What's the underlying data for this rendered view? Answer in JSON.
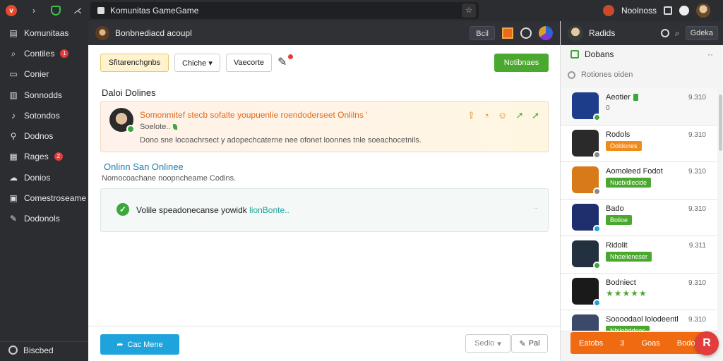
{
  "topbar": {
    "address": "Komunitas GameGame",
    "user_name": "Noolnoss"
  },
  "sidebar": {
    "items": [
      {
        "label": "Komunitaas",
        "icon": "layout-icon",
        "badge": ""
      },
      {
        "label": "Contiles",
        "icon": "search-icon",
        "badge": "1"
      },
      {
        "label": "Conier",
        "icon": "chat-icon",
        "badge": ""
      },
      {
        "label": "Sonnodds",
        "icon": "book-icon",
        "badge": ""
      },
      {
        "label": "Sotondos",
        "icon": "guitar-icon",
        "badge": ""
      },
      {
        "label": "Dodnos",
        "icon": "person-icon",
        "badge": ""
      },
      {
        "label": "Rages",
        "icon": "grid-icon",
        "badge": "2"
      },
      {
        "label": "Donios",
        "icon": "cloud-icon",
        "badge": ""
      },
      {
        "label": "Comestroseame",
        "icon": "image-icon",
        "badge": ""
      },
      {
        "label": "Dodonols",
        "icon": "pen-icon",
        "badge": ""
      }
    ],
    "footer_label": "Biscbed"
  },
  "main_header": {
    "group_name": "Bonbnediacd acoupl",
    "button_label": "Bcil"
  },
  "toolbar": {
    "yellow_label": "Sfitarenchgnbs",
    "dropdown_label": "Chiche",
    "outline_label": "Vaecorte",
    "green_label": "Notibnaes"
  },
  "section1": {
    "title": "Daloi Dolines",
    "alert_title": "Somonmitef stecb sofalte youpuenlie roendoderseet Onlilns '",
    "alert_sub": "Soelote..",
    "alert_body": "Dono sne locoachrsect y adopechcaterne nee ofonet loonnes tnle soeachocetnils."
  },
  "section2": {
    "title": "Onlinn San Onlinee",
    "subtitle": "Nomocoachane noopncheame Codins.",
    "msg_main": "Volile speadonecanse yowidk",
    "msg_link": "lionBonte..",
    "more": "··"
  },
  "footer": {
    "primary_label": "Cac Mene",
    "select_label": "Sedio",
    "pin_label": "Pal"
  },
  "right_panel": {
    "header_name": "Radids",
    "header_btn": "Gdeka",
    "title": "Dobans",
    "more": "··",
    "sort_label": "Rotiones oiden",
    "items": [
      {
        "name": "Aeotier",
        "meta": "0",
        "pill": "",
        "pill_color": "",
        "time": "9.310",
        "thumb": "#1d3c8a"
      },
      {
        "name": "Rodols",
        "meta": "",
        "pill": "Ooldones",
        "pill_color": "orange",
        "time": "9.310",
        "thumb": "#2a2a2a"
      },
      {
        "name": "Aomoleed Fodot",
        "meta": "",
        "pill": "Nuebidlecide",
        "pill_color": "green",
        "time": "9.310",
        "thumb": "#d97a1a"
      },
      {
        "name": "Bado",
        "meta": "",
        "pill": "Bolioe",
        "pill_color": "green",
        "time": "9.310",
        "thumb": "#1f2f6e"
      },
      {
        "name": "Ridolit",
        "meta": "",
        "pill": "Nhdelieneser",
        "pill_color": "green",
        "time": "9.311",
        "thumb": "#233040"
      },
      {
        "name": "Bodniect",
        "meta": "★★★★★",
        "pill": "",
        "pill_color": "",
        "time": "9.310",
        "thumb": "#1a1a1a"
      },
      {
        "name": "Soooodaol lolodeentl",
        "meta": "",
        "pill": "Nhilehddoes",
        "pill_color": "green",
        "time": "9.310",
        "thumb": "#3b4a6a"
      }
    ],
    "footer_left": "Eatobs",
    "footer_mid": "3",
    "footer_right": "Goas",
    "footer_right2": "Bodos",
    "fab_label": "R"
  }
}
